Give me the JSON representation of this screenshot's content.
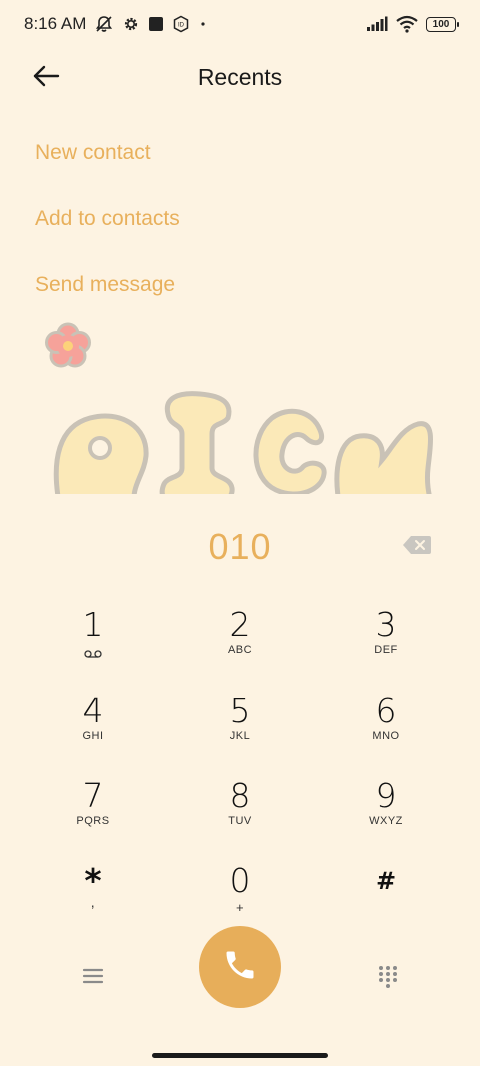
{
  "status_bar": {
    "time": "8:16 AM",
    "battery": "100",
    "icons": [
      "mute-icon",
      "settings-gear-icon",
      "app-square-icon",
      "vpn-badge-icon",
      "dot-icon",
      "signal-icon",
      "wifi-icon",
      "battery-icon"
    ]
  },
  "header": {
    "title": "Recents",
    "back_icon": "arrow-left-icon"
  },
  "actions": {
    "new_contact": "New contact",
    "add_to_contacts": "Add to contacts",
    "send_message": "Send message"
  },
  "decoration": {
    "text": "RICH"
  },
  "dialer": {
    "number": "010",
    "keys": [
      {
        "digit": "1",
        "sub": ""
      },
      {
        "digit": "2",
        "sub": "ABC"
      },
      {
        "digit": "3",
        "sub": "DEF"
      },
      {
        "digit": "4",
        "sub": "GHI"
      },
      {
        "digit": "5",
        "sub": "JKL"
      },
      {
        "digit": "6",
        "sub": "MNO"
      },
      {
        "digit": "7",
        "sub": "PQRS"
      },
      {
        "digit": "8",
        "sub": "TUV"
      },
      {
        "digit": "9",
        "sub": "WXYZ"
      },
      {
        "digit": "*",
        "sub": ","
      },
      {
        "digit": "0",
        "sub": "+"
      },
      {
        "digit": "#",
        "sub": ""
      }
    ]
  },
  "colors": {
    "background": "#fdf3e2",
    "accent": "#e8b05c",
    "call_button": "#e7ae5a"
  }
}
